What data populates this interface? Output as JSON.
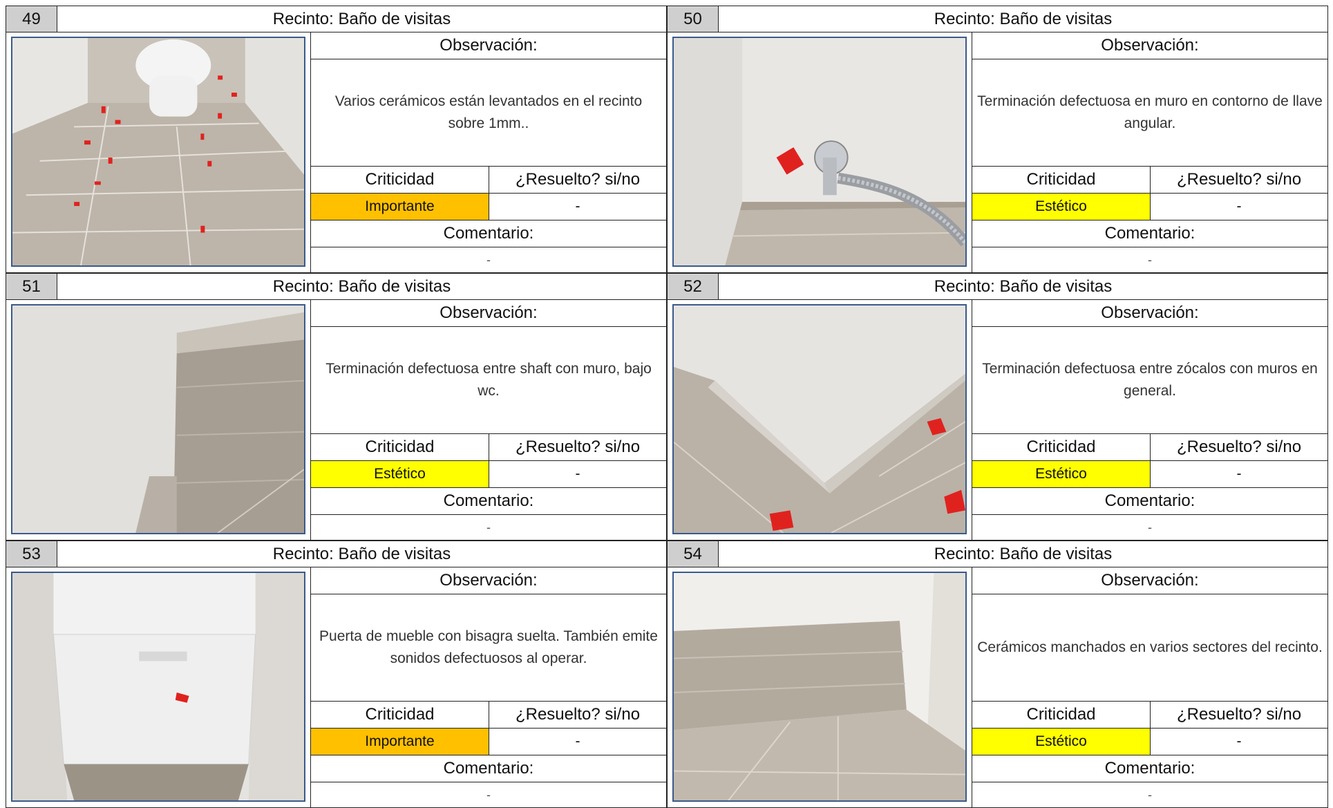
{
  "labels": {
    "observacion": "Observación:",
    "criticidad": "Criticidad",
    "resuelto": "¿Resuelto? si/no",
    "comentario": "Comentario:"
  },
  "colors": {
    "importante": "#ffc000",
    "estetico": "#ffff00"
  },
  "items": [
    {
      "num": "49",
      "recinto": "Recinto: Baño de visitas",
      "observacion": "Varios cerámicos están levantados en el recinto sobre 1mm..",
      "criticidad": "Importante",
      "crit_color": "#ffc000",
      "resuelto": "-",
      "comentario": "-",
      "photo": "bathroom-floor-toilet-photo"
    },
    {
      "num": "50",
      "recinto": "Recinto: Baño de visitas",
      "observacion": "Terminación defectuosa en muro en contorno de llave angular.",
      "criticidad": "Estético",
      "crit_color": "#ffff00",
      "resuelto": "-",
      "comentario": "-",
      "photo": "angle-valve-wall-photo"
    },
    {
      "num": "51",
      "recinto": "Recinto: Baño de visitas",
      "observacion": "Terminación defectuosa entre shaft con muro, bajo wc.",
      "criticidad": "Estético",
      "crit_color": "#ffff00",
      "resuelto": "-",
      "comentario": "-",
      "photo": "shaft-wall-photo"
    },
    {
      "num": "52",
      "recinto": "Recinto: Baño de visitas",
      "observacion": "Terminación defectuosa entre zócalos con muros en general.",
      "criticidad": "Estético",
      "crit_color": "#ffff00",
      "resuelto": "-",
      "comentario": "-",
      "photo": "skirting-corner-photo"
    },
    {
      "num": "53",
      "recinto": "Recinto: Baño de visitas",
      "observacion": "Puerta de mueble con bisagra suelta. También emite sonidos defectuosos al operar.",
      "criticidad": "Importante",
      "crit_color": "#ffc000",
      "resuelto": "-",
      "comentario": "-",
      "photo": "cabinet-door-photo"
    },
    {
      "num": "54",
      "recinto": "Recinto: Baño de visitas",
      "observacion": "Cerámicos manchados en varios sectores del recinto.",
      "criticidad": "Estético",
      "crit_color": "#ffff00",
      "resuelto": "-",
      "comentario": "-",
      "photo": "stained-tiles-photo"
    }
  ]
}
